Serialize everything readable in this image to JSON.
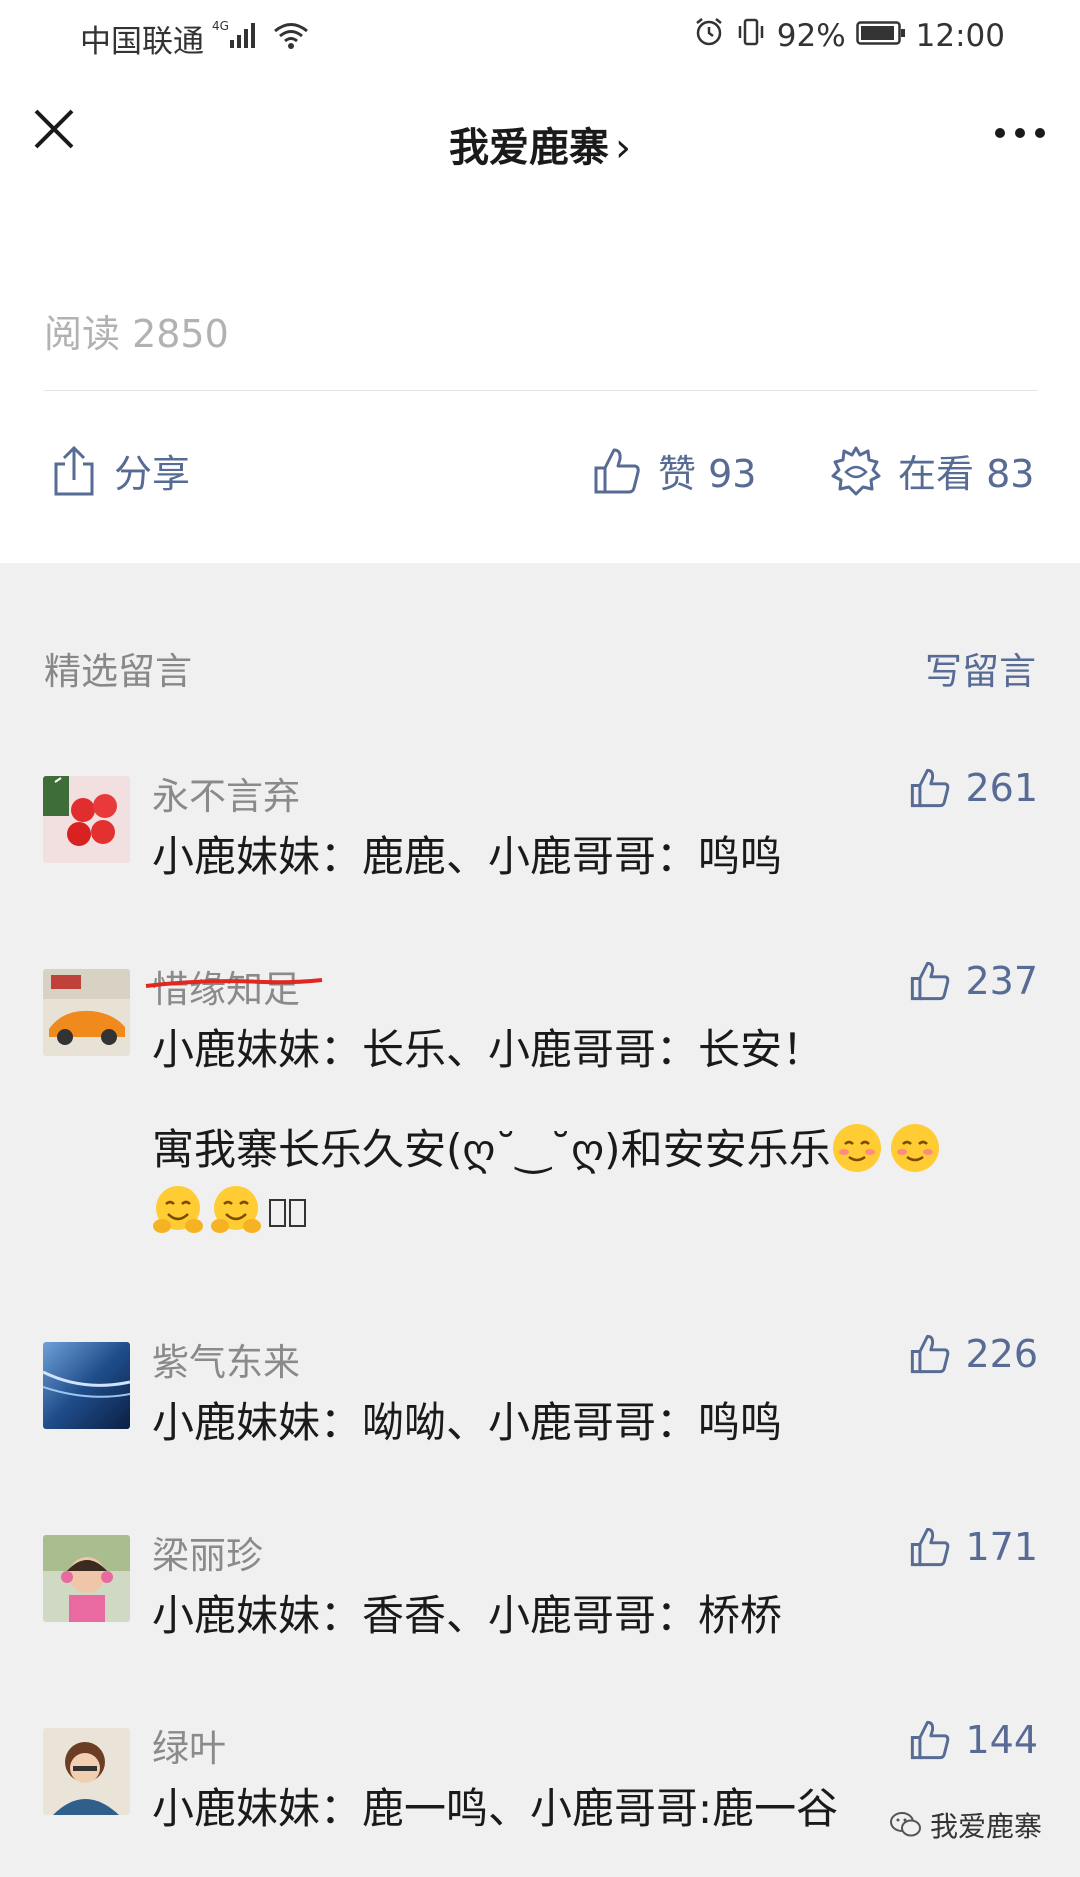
{
  "status_bar": {
    "carrier": "中国联通",
    "network": "4G",
    "battery": "92%",
    "time": "12:00"
  },
  "nav": {
    "title": "我爱鹿寨",
    "chevron": "›"
  },
  "article": {
    "read_count": "阅读 2850",
    "share_label": "分享",
    "like_label": "赞 93",
    "watching_label": "在看 83"
  },
  "comments_section": {
    "title": "精选留言",
    "write_label": "写留言",
    "items": [
      {
        "name": "永不言弃",
        "text": "小鹿妹妹：鹿鹿、小鹿哥哥：鸣鸣",
        "likes": "261",
        "avatar_color": "#f5d8d8",
        "name_struck": false
      },
      {
        "name": "惜缘知足",
        "text": "小鹿妹妹：长乐、小鹿哥哥：长安！",
        "extra_text": "寓我寨长乐久安(ღ˘‿˘ღ)和安安乐乐",
        "likes": "237",
        "avatar_color": "#e0801a",
        "name_struck": true
      },
      {
        "name": "紫气东来",
        "text": "小鹿妹妹：呦呦、小鹿哥哥：鸣鸣",
        "likes": "226",
        "avatar_color": "#3d6fa8",
        "name_struck": false
      },
      {
        "name": "梁丽珍",
        "text": "小鹿妹妹：香香、小鹿哥哥：桥桥",
        "likes": "171",
        "avatar_color": "#c9b7a5",
        "name_struck": false
      },
      {
        "name": "绿叶",
        "text": "小鹿妹妹：鹿一鸣、小鹿哥哥:鹿一谷",
        "likes": "144",
        "avatar_color": "#b88f65",
        "name_struck": false
      }
    ]
  },
  "watermark": {
    "text": "我爱鹿寨"
  },
  "colors": {
    "link": "#576b95",
    "comments_bg": "#f0f0f0",
    "strike": "#e0281f"
  }
}
